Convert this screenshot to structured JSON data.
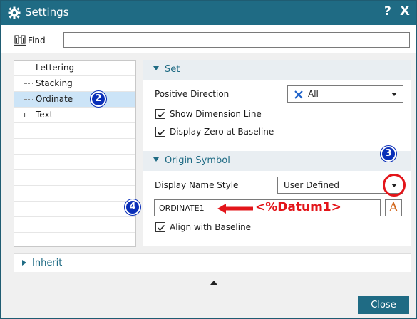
{
  "window": {
    "title": "Settings",
    "help_label": "?",
    "close_label": "X"
  },
  "find": {
    "label": "Find",
    "value": ""
  },
  "tree": {
    "items": [
      {
        "label": "Lettering"
      },
      {
        "label": "Stacking"
      },
      {
        "label": "Ordinate",
        "selected": true
      },
      {
        "label": "Text",
        "expand": "+"
      }
    ]
  },
  "set_section": {
    "title": "Set",
    "positive_direction_label": "Positive Direction",
    "positive_direction_value": "All",
    "show_dimension_line": "Show Dimension Line",
    "display_zero": "Display Zero at Baseline"
  },
  "origin_section": {
    "title": "Origin Symbol",
    "display_name_style_label": "Display Name Style",
    "display_name_style_value": "User Defined",
    "name_value": "ORDINATE1",
    "font_button": "A",
    "align_with_baseline": "Align with Baseline"
  },
  "annotations": {
    "badge2": "2",
    "badge3": "3",
    "badge4": "4",
    "datum_text": "<%Datum1>",
    "color": "#e3151a",
    "badge_color": "#0a2fb8"
  },
  "inherit": {
    "label": "Inherit"
  },
  "footer": {
    "close_label": "Close"
  },
  "colors": {
    "accent": "#1f6b84",
    "selection": "#cce4f7"
  }
}
